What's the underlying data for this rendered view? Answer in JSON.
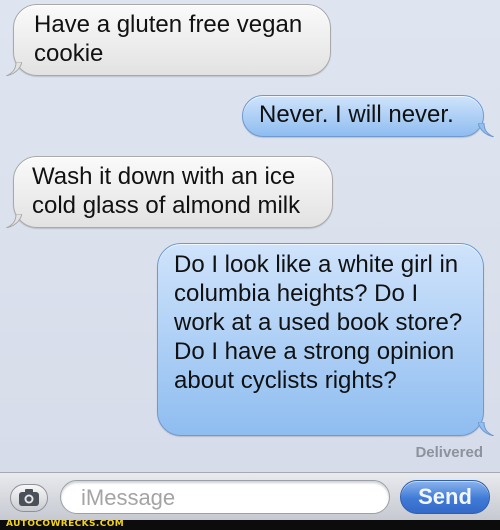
{
  "messages": [
    {
      "side": "received",
      "text": "Have a gluten free vegan cookie"
    },
    {
      "side": "sent",
      "text": "Never. I will never."
    },
    {
      "side": "received",
      "text": "Wash it down with an ice cold glass of almond milk"
    },
    {
      "side": "sent",
      "text": "Do I look like a white girl in columbia heights? Do I work at a used book store? Do I have a strong opinion about cyclists rights?"
    }
  ],
  "status": {
    "delivered": "Delivered"
  },
  "input": {
    "placeholder": "iMessage",
    "value": ""
  },
  "buttons": {
    "send": "Send",
    "camera_icon": "camera-icon"
  },
  "watermark": {
    "text": "AUTOCOWRECKS.COM"
  },
  "colors": {
    "background": "#dbe1ed",
    "received_bubble": "#f0f0f0",
    "sent_bubble": "#a9ccf5",
    "send_button": "#3f7ad6",
    "watermark_text": "#f2d21a"
  }
}
